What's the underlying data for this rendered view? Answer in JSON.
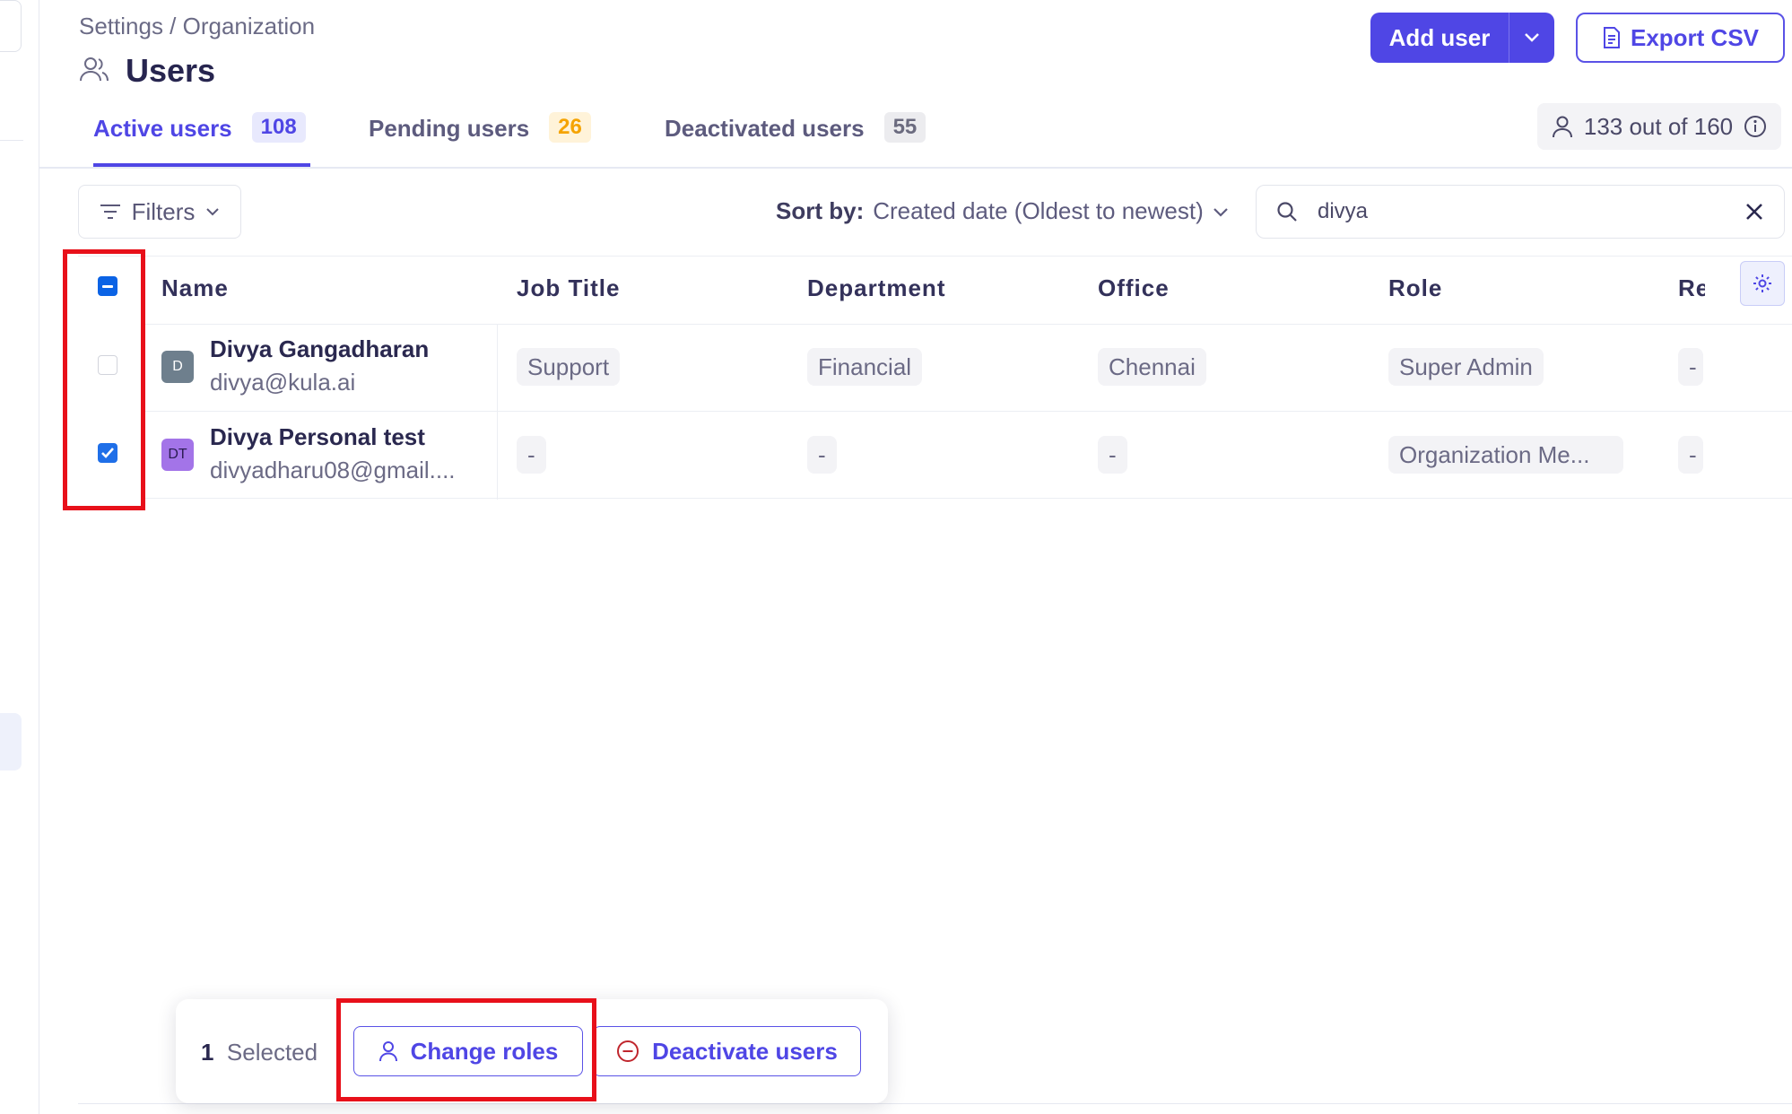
{
  "breadcrumb": "Settings / Organization",
  "page_title": "Users",
  "header": {
    "add_user_label": "Add user",
    "export_label": "Export CSV"
  },
  "tabs": [
    {
      "label": "Active users",
      "count": "108"
    },
    {
      "label": "Pending users",
      "count": "26"
    },
    {
      "label": "Deactivated users",
      "count": "55"
    }
  ],
  "quota": "133 out of 160",
  "toolbar": {
    "filters_label": "Filters",
    "sort_prefix": "Sort by:",
    "sort_value": "Created date (Oldest to newest)",
    "search_value": "divya"
  },
  "columns": [
    "Name",
    "Job Title",
    "Department",
    "Office",
    "Role",
    "Re"
  ],
  "rows": [
    {
      "initials": "D",
      "name": "Divya Gangadharan",
      "email": "divya@kula.ai",
      "job_title": "Support",
      "department": "Financial",
      "office": "Chennai",
      "role": "Super Admin",
      "extra": "-",
      "selected": false
    },
    {
      "initials": "DT",
      "name": "Divya Personal test",
      "email": "divyadharu08@gmail....",
      "job_title": "-",
      "department": "-",
      "office": "-",
      "role": "Organization Me...",
      "extra": "-",
      "selected": true
    }
  ],
  "action_bar": {
    "selected_count": "1",
    "selected_label": "Selected",
    "change_roles_label": "Change roles",
    "deactivate_label": "Deactivate users"
  },
  "colors": {
    "accent": "#4f46e5",
    "highlight": "#e8101a",
    "pending": "#f5a300",
    "danger": "#c0262d",
    "avatar_d": "#6e7f8d",
    "avatar_dt": "#a374e8"
  }
}
